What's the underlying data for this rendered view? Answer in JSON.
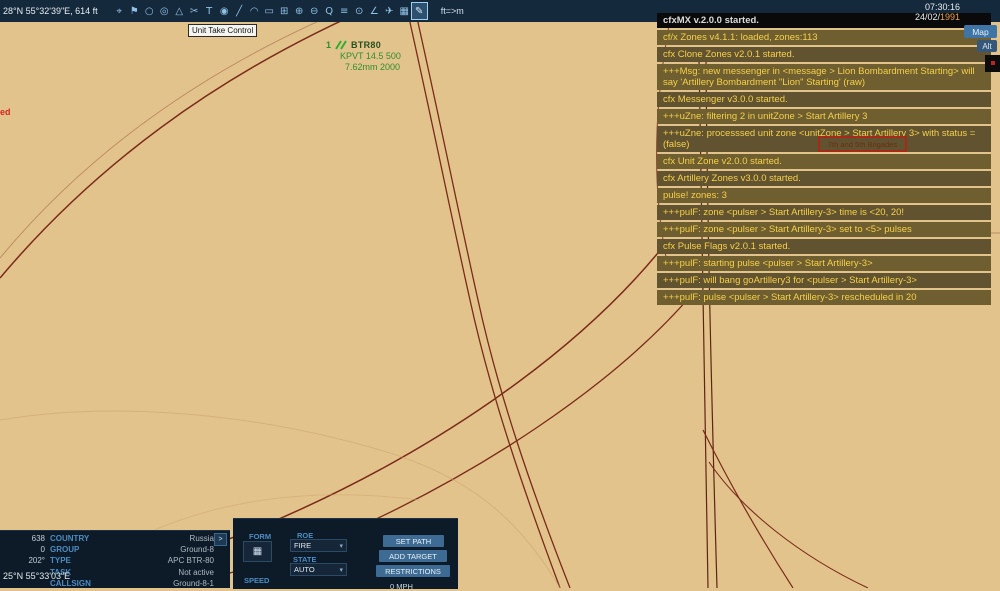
{
  "top_bar": {
    "coordinates": "28°N 55°32'39\"E, 614 ft",
    "unit_toggle": "ft=>m",
    "icons": [
      {
        "name": "select-tool-icon",
        "glyph": "⌖"
      },
      {
        "name": "flag-icon",
        "glyph": "⚑"
      },
      {
        "name": "circle-tool-icon",
        "glyph": "○"
      },
      {
        "name": "ring-tool-icon",
        "glyph": "◎"
      },
      {
        "name": "polygon-tool-icon",
        "glyph": "△"
      },
      {
        "name": "scissors-icon",
        "glyph": "✂"
      },
      {
        "name": "text-tool-icon",
        "glyph": "T"
      },
      {
        "name": "marker-icon",
        "glyph": "◉"
      },
      {
        "name": "line-tool-icon",
        "glyph": "╱"
      },
      {
        "name": "arc-tool-icon",
        "glyph": "◠"
      },
      {
        "name": "rect-tool-icon",
        "glyph": "▭"
      },
      {
        "name": "grid-icon",
        "glyph": "⊞"
      },
      {
        "name": "zoom-in-icon",
        "glyph": "⊕"
      },
      {
        "name": "zoom-out-icon",
        "glyph": "⊖"
      },
      {
        "name": "search-icon",
        "glyph": "Q"
      },
      {
        "name": "layers-icon",
        "glyph": "≡"
      },
      {
        "name": "target-icon",
        "glyph": "⊙"
      },
      {
        "name": "angle-icon",
        "glyph": "∠"
      },
      {
        "name": "plane-icon",
        "glyph": "✈"
      },
      {
        "name": "pattern-icon",
        "glyph": "▦"
      },
      {
        "name": "pencil-icon",
        "glyph": "✎"
      }
    ]
  },
  "clock": {
    "time": "07:30:16",
    "date_prefix": "24/02/",
    "date_year": "1991"
  },
  "side_buttons": {
    "map": "Map",
    "alt": "Alt"
  },
  "tooltip": {
    "text": "Unit  Take Control"
  },
  "map": {
    "unit": {
      "count": "1",
      "name": "BTR80",
      "ammo_primary": "KPVT 14.5 500",
      "ammo_secondary": "7.62mm 2000"
    },
    "edge_text": "ed",
    "cursor_coordinates": "25°N 55°33'03\"E",
    "zone_label": "7th and 5th Brigades"
  },
  "message_log": {
    "header": "cfxMX v.2.0.0 started.",
    "messages": [
      "cf/x Zones v4.1.1: loaded, zones:113",
      "cfx Clone Zones v2.0.1 started.",
      "+++Msg: new messenger in <message > Lion Bombardment Starting> will say 'Artillery Bombardment \"Lion\" Starting' (raw)",
      "cfx Messenger v3.0.0 started.",
      "+++uZne: filtering 2 in unitZone > Start Artillery 3",
      "+++uZne: processsed unit zone <unitZone > Start Artillery 3> with status = (false)",
      "cfx Unit Zone v2.0.0 started.",
      "cfx Artillery Zones v3.0.0 started.",
      "pulse! zones: 3",
      "+++pulF: zone <pulser > Start Artillery-3> time is <20, 20!",
      "+++pulF: zone <pulser > Start Artillery-3> set to <5> pulses",
      "cfx Pulse Flags v2.0.1 started.",
      "+++pulF: starting pulse <pulser > Start Artillery-3>",
      "+++pulF: will bang goArtillery3 for <pulser > Start Artillery-3>",
      "+++pulF: pulse <pulser > Start Artillery-3> rescheduled in 20"
    ]
  },
  "unit_panel": {
    "expand": ">",
    "rows": [
      {
        "value": "638",
        "label": "COUNTRY",
        "data": "Russia"
      },
      {
        "value": "0",
        "label": "GROUP",
        "data": "Ground-8"
      },
      {
        "value": "202°",
        "label": "TYPE",
        "data": "APC BTR-80"
      },
      {
        "value": "",
        "label": "TASK",
        "data": "Not active"
      },
      {
        "value": "",
        "label": "CALLSIGN",
        "data": "Ground-8-1"
      }
    ]
  },
  "control_panel": {
    "form_label": "FORM",
    "form_icon": "▦",
    "roe_label": "ROE",
    "roe_value": "FIRE",
    "state_label": "STATE",
    "state_value": "AUTO",
    "speed_label": "SPEED",
    "speed_value": "0 MPH",
    "dropdown_arrow": "▾",
    "buttons": [
      {
        "label": "SET PATH"
      },
      {
        "label": "ADD TARGET"
      },
      {
        "label": "RESTRICTIONS"
      }
    ]
  },
  "colors": {
    "map_background": "#e3c38c",
    "road_line": "#7a2b19",
    "log_text": "#f5d14b",
    "panel_background": "#0d1b29",
    "accent_blue": "#4c8cc2",
    "unit_green": "#2e8f2e",
    "alert_red": "#a52a17"
  }
}
